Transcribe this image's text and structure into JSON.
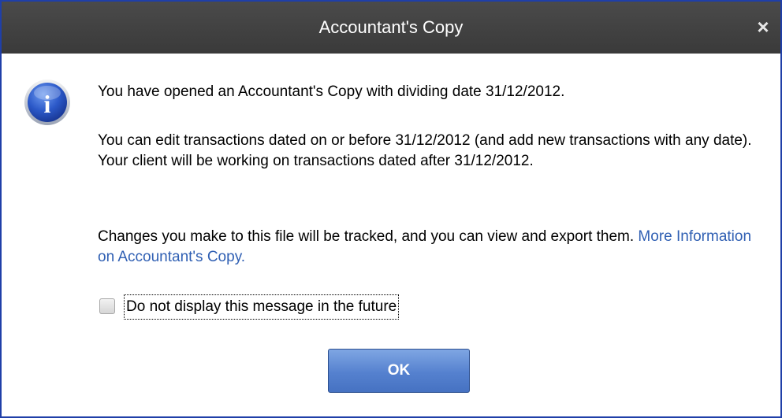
{
  "window": {
    "title": "Accountant's Copy",
    "close_label": "×"
  },
  "icon": {
    "name": "info-icon",
    "glyph": "i"
  },
  "message": {
    "line1": "You have opened an Accountant's Copy with dividing date 31/12/2012.",
    "para2": "You can edit transactions dated on or before 31/12/2012 (and add new transactions with any date). Your client will be working on transactions dated after 31/12/2012.",
    "para3_text": "Changes you make to this file will be tracked, and you can view and export them.",
    "para3_link": "More Information on Accountant's Copy."
  },
  "checkbox": {
    "label": "Do not display this message in the future",
    "checked": false
  },
  "buttons": {
    "ok_label": "OK"
  },
  "colors": {
    "titlebar": "#3f3f3f",
    "link": "#2f5fb3",
    "button": "#5581cf",
    "border": "#1f3fa8"
  }
}
